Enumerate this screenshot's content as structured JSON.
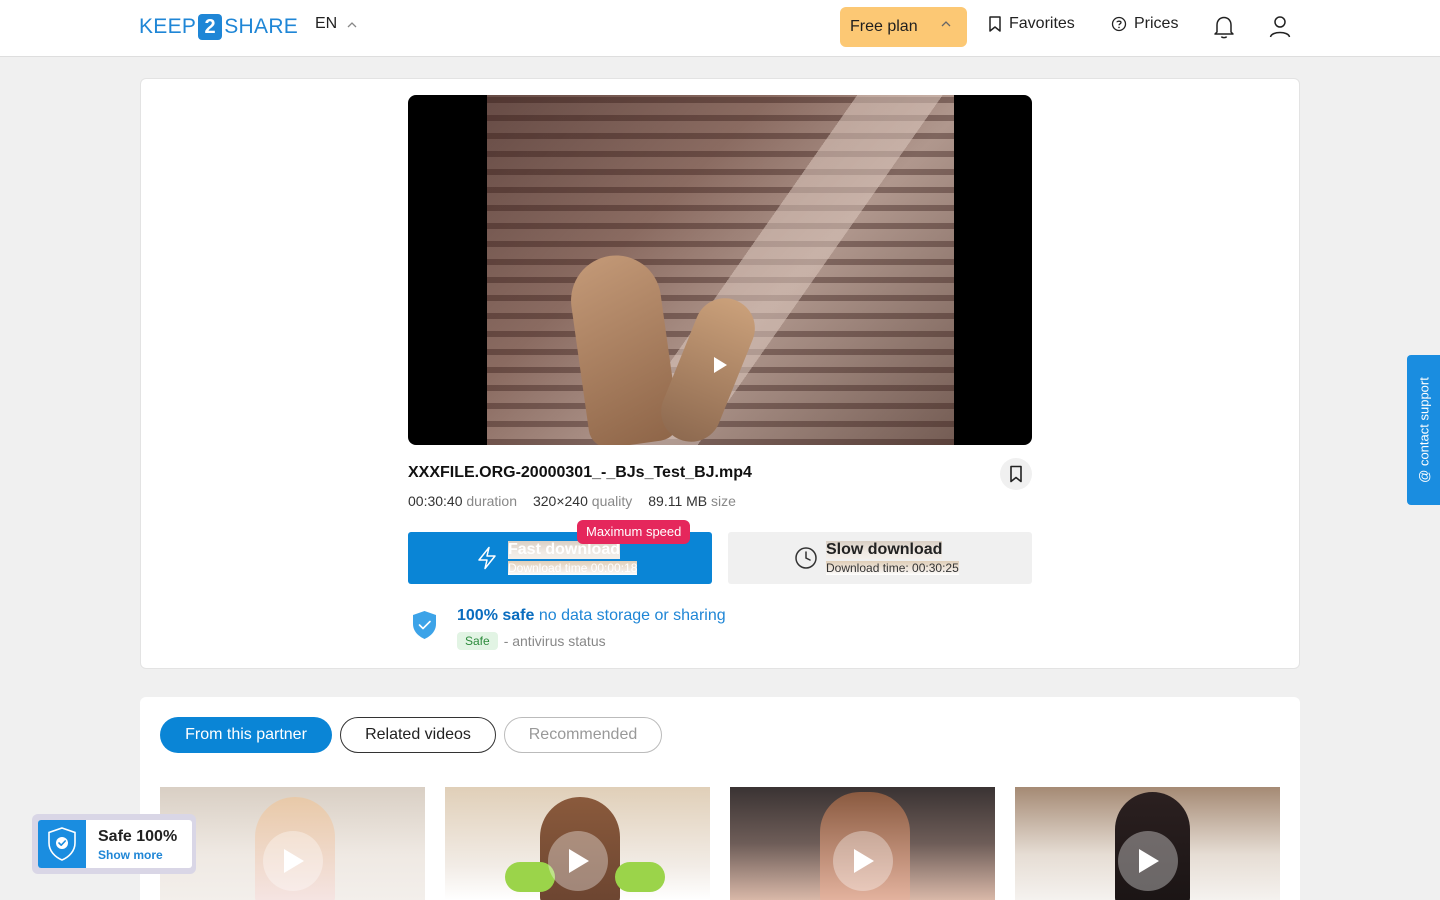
{
  "header": {
    "logo_left": "KEEP",
    "logo_mid": "2",
    "logo_right": "SHARE",
    "language": "EN",
    "free_plan": "Free plan",
    "favorites": "Favorites",
    "prices": "Prices"
  },
  "file": {
    "title": "XXXFILE.ORG-20000301_-_BJs_Test_BJ.mp4",
    "duration_value": "00:30:40",
    "duration_label": "duration",
    "quality_value": "320×240",
    "quality_label": "quality",
    "size_value": "89.11 MB",
    "size_label": "size"
  },
  "download": {
    "fast_label": "Fast download",
    "fast_time": "Download time 00:00:18",
    "max_speed": "Maximum speed",
    "slow_label": "Slow download",
    "slow_time": "Download time: 00:30:25"
  },
  "safety": {
    "strong": "100% safe",
    "rest": "no data storage or sharing",
    "badge": "Safe",
    "antivirus": "- antivirus status"
  },
  "support": {
    "label": "@ contact support"
  },
  "tabs": [
    {
      "label": "From this partner",
      "active": true
    },
    {
      "label": "Related videos",
      "active": false
    },
    {
      "label": "Recommended",
      "active": false
    }
  ],
  "safe_badge": {
    "title": "Safe 100%",
    "link": "Show more"
  },
  "colors": {
    "accent": "#0a85d6",
    "plan": "#fcc874",
    "max_speed": "#e5275c"
  }
}
